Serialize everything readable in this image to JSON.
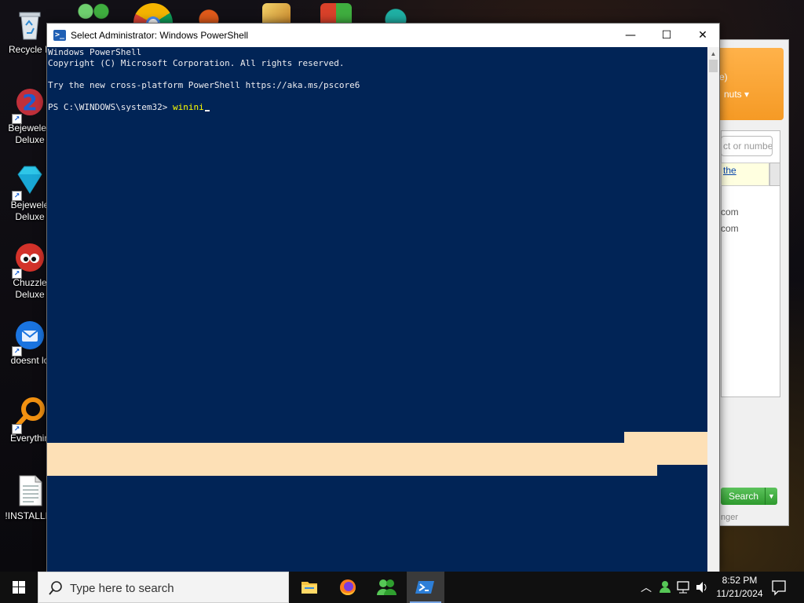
{
  "desktop": {
    "icons": [
      {
        "label": "Recycle B",
        "icon": "recycle-bin-icon"
      },
      {
        "label": "Bejeweled\nDeluxe",
        "icon": "bejeweled2-icon"
      },
      {
        "label": "Bejewele\nDeluxe",
        "icon": "diamond-icon"
      },
      {
        "label": "Chuzzle\nDeluxe",
        "icon": "chuzzle-icon"
      },
      {
        "label": "doesnt lo",
        "icon": "thunderbird-icon"
      },
      {
        "label": "Everythin",
        "icon": "everything-search-icon"
      },
      {
        "label": "!INSTALLIN",
        "icon": "text-document-icon"
      }
    ]
  },
  "bg_app": {
    "dropdown1": "e)",
    "dropdown2": "nuts",
    "input_placeholder": "ct or numbe",
    "tip_link": "the",
    "lines": [
      "com",
      "com"
    ],
    "search_label": "Search",
    "footer": "nger"
  },
  "powershell": {
    "title": "Select Administrator: Windows PowerShell",
    "console_lines": [
      "Windows PowerShell",
      "Copyright (C) Microsoft Corporation. All rights reserved.",
      "",
      "Try the new cross-platform PowerShell https://aka.ms/pscore6",
      ""
    ],
    "prompt": "PS C:\\WINDOWS\\system32> ",
    "command": "winini",
    "colors": {
      "console_bg": "#012456",
      "text": "#eeedf0",
      "command": "#ffff00",
      "selection": "#fde0b6"
    }
  },
  "taskbar": {
    "search_placeholder": "Type here to search",
    "apps": [
      "file-explorer-icon",
      "firefox-icon",
      "people-icon",
      "powershell-icon"
    ],
    "time": "8:52 PM",
    "date": "11/21/2024"
  }
}
